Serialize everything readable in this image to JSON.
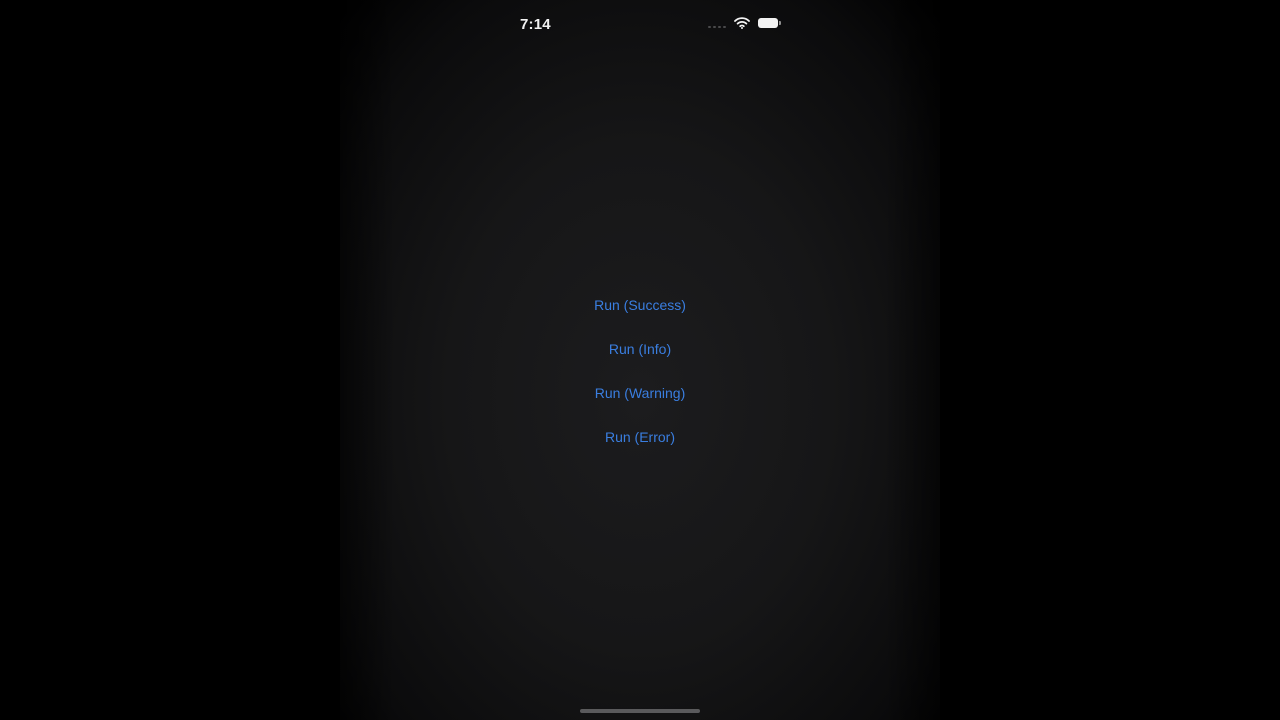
{
  "status_bar": {
    "time": "7:14",
    "icons": [
      "cellular-signal-icon",
      "wifi-icon",
      "battery-icon"
    ]
  },
  "buttons": [
    {
      "label": "Run (Success)"
    },
    {
      "label": "Run (Info)"
    },
    {
      "label": "Run (Warning)"
    },
    {
      "label": "Run (Error)"
    }
  ],
  "colors": {
    "accent": "#3a7ee0",
    "background": "#1c1c1e",
    "status_text": "#f2f2f2"
  }
}
